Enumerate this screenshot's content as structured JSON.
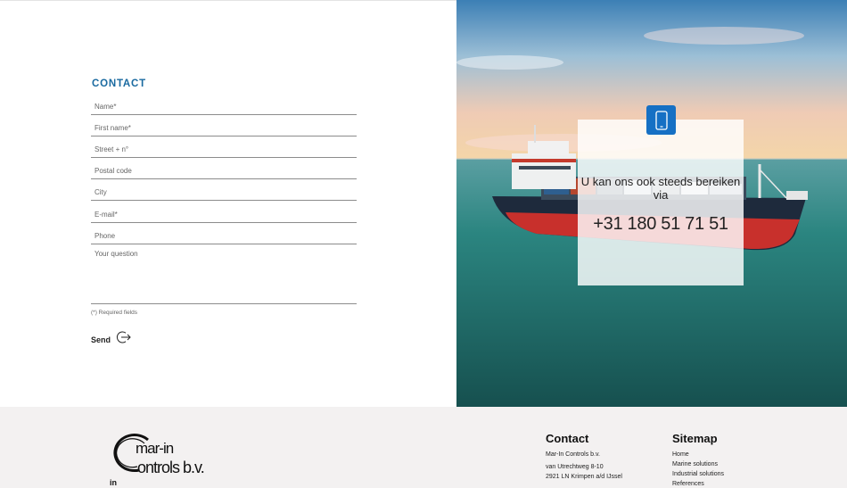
{
  "form": {
    "title": "CONTACT",
    "fields": {
      "name": "Name*",
      "first_name": "First name*",
      "street": "Street + n°",
      "postal_code": "Postal code",
      "city": "City",
      "email": "E-mail*",
      "phone": "Phone",
      "question": "Your question"
    },
    "required_note": "(*) Required fields",
    "send_label": "Send"
  },
  "callout": {
    "text": "U kan ons ook steeds bereiken via",
    "phone": "+31 180 51 71 51",
    "icon": "smartphone-icon"
  },
  "footer": {
    "logo_line1": "mar-in",
    "logo_line2": "ontrols b.v.",
    "social": "in",
    "contact": {
      "heading": "Contact",
      "company": "Mar-In Controls b.v.",
      "street": "van Utrechtweg 8-10",
      "city": "2921 LN  Krimpen a/d IJssel"
    },
    "sitemap": {
      "heading": "Sitemap",
      "links": [
        "Home",
        "Marine solutions",
        "Industrial solutions",
        "References"
      ]
    }
  },
  "colors": {
    "accent": "#1a6aa0",
    "badge": "#1670c4",
    "footer_bg": "#f3f1f1"
  }
}
